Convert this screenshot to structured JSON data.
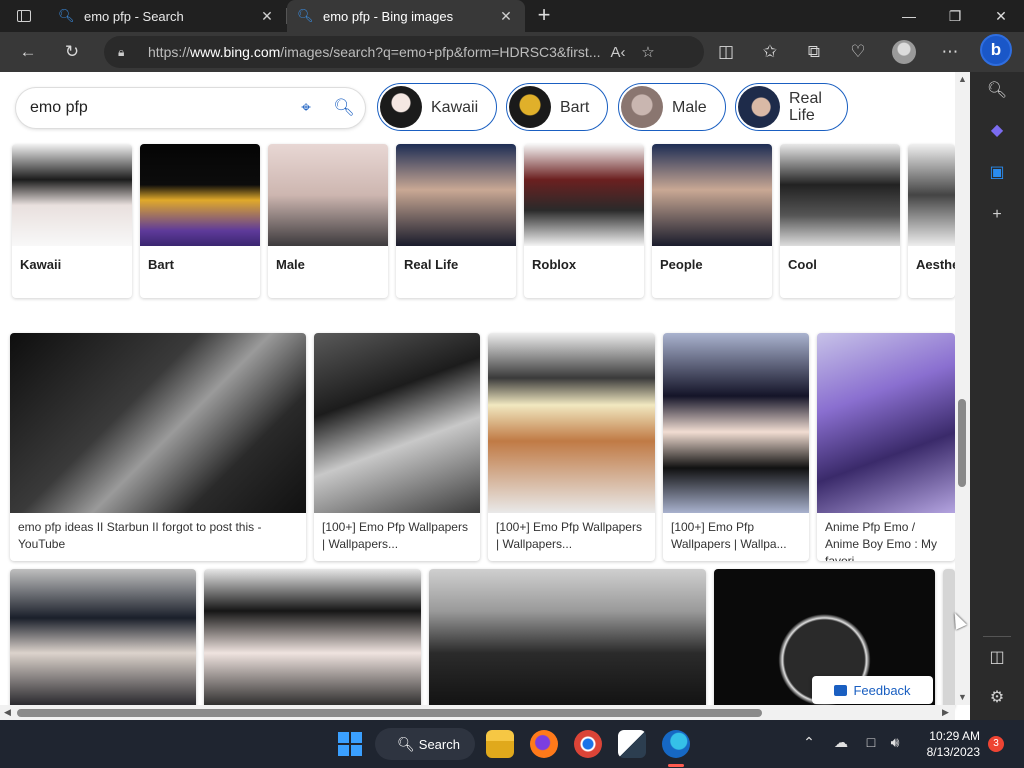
{
  "browser": {
    "tabs": [
      {
        "title": "emo pfp - Search",
        "icon": "search-icon",
        "active": false
      },
      {
        "title": "emo pfp - Bing images",
        "icon": "search-icon",
        "active": true
      }
    ],
    "url_prefix": "https://",
    "url_domain": "www.bing.com",
    "url_rest": "/images/search?q=emo+pfp&form=HDRSC3&first..."
  },
  "search": {
    "query": "emo pfp"
  },
  "related_chips": [
    {
      "label": "Kawaii"
    },
    {
      "label": "Bart"
    },
    {
      "label": "Male"
    },
    {
      "label": "Real Life"
    }
  ],
  "categories": [
    {
      "label": "Kawaii"
    },
    {
      "label": "Bart"
    },
    {
      "label": "Male"
    },
    {
      "label": "Real Life"
    },
    {
      "label": "Roblox"
    },
    {
      "label": "People"
    },
    {
      "label": "Cool"
    },
    {
      "label": "Aesthe"
    }
  ],
  "results_row1": [
    {
      "caption": "emo pfp ideas II Starbun II forgot to post this - YouTube"
    },
    {
      "caption": "[100+] Emo Pfp Wallpapers | Wallpapers..."
    },
    {
      "caption": "[100+] Emo Pfp Wallpapers | Wallpapers..."
    },
    {
      "caption": "[100+] Emo Pfp Wallpapers | Wallpa..."
    },
    {
      "caption": "Anime Pfp Emo / Anime Boy Emo : My favori..."
    }
  ],
  "feedback_label": "Feedback",
  "taskbar": {
    "search_label": "Search",
    "time": "10:29 AM",
    "date": "8/13/2023",
    "notifications": "3"
  }
}
